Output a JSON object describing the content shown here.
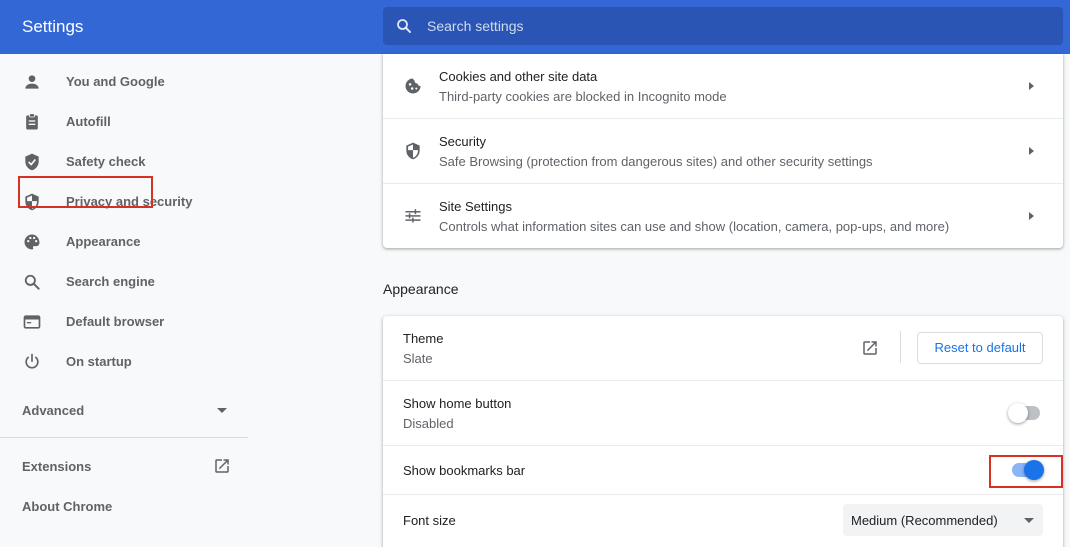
{
  "header": {
    "title": "Settings",
    "search_placeholder": "Search settings"
  },
  "sidebar": {
    "items": [
      {
        "label": "You and Google",
        "icon": "person-icon"
      },
      {
        "label": "Autofill",
        "icon": "clipboard-icon"
      },
      {
        "label": "Safety check",
        "icon": "shield-check-icon"
      },
      {
        "label": "Privacy and security",
        "icon": "shield-half-icon"
      },
      {
        "label": "Appearance",
        "icon": "palette-icon",
        "highlighted": true
      },
      {
        "label": "Search engine",
        "icon": "search-icon"
      },
      {
        "label": "Default browser",
        "icon": "browser-window-icon"
      },
      {
        "label": "On startup",
        "icon": "power-icon"
      }
    ],
    "advanced_label": "Advanced",
    "extensions_label": "Extensions",
    "about_label": "About Chrome"
  },
  "privacy_card": {
    "rows": [
      {
        "title": "Cookies and other site data",
        "subtitle": "Third-party cookies are blocked in Incognito mode",
        "icon": "cookie-icon"
      },
      {
        "title": "Security",
        "subtitle": "Safe Browsing (protection from dangerous sites) and other security settings",
        "icon": "shield-half-icon"
      },
      {
        "title": "Site Settings",
        "subtitle": "Controls what information sites can use and show (location, camera, pop-ups, and more)",
        "icon": "tune-sliders-icon"
      }
    ]
  },
  "appearance": {
    "section_title": "Appearance",
    "theme": {
      "title": "Theme",
      "value": "Slate",
      "reset_label": "Reset to default"
    },
    "home_button": {
      "title": "Show home button",
      "value": "Disabled",
      "enabled": false
    },
    "bookmarks_bar": {
      "title": "Show bookmarks bar",
      "enabled": true,
      "highlighted": true
    },
    "font_size": {
      "title": "Font size",
      "selected": "Medium (Recommended)"
    }
  },
  "colors": {
    "header_bg": "#3367d6",
    "search_bg": "#2a55b4",
    "accent": "#1a73e8",
    "highlight_box": "#d93025"
  }
}
